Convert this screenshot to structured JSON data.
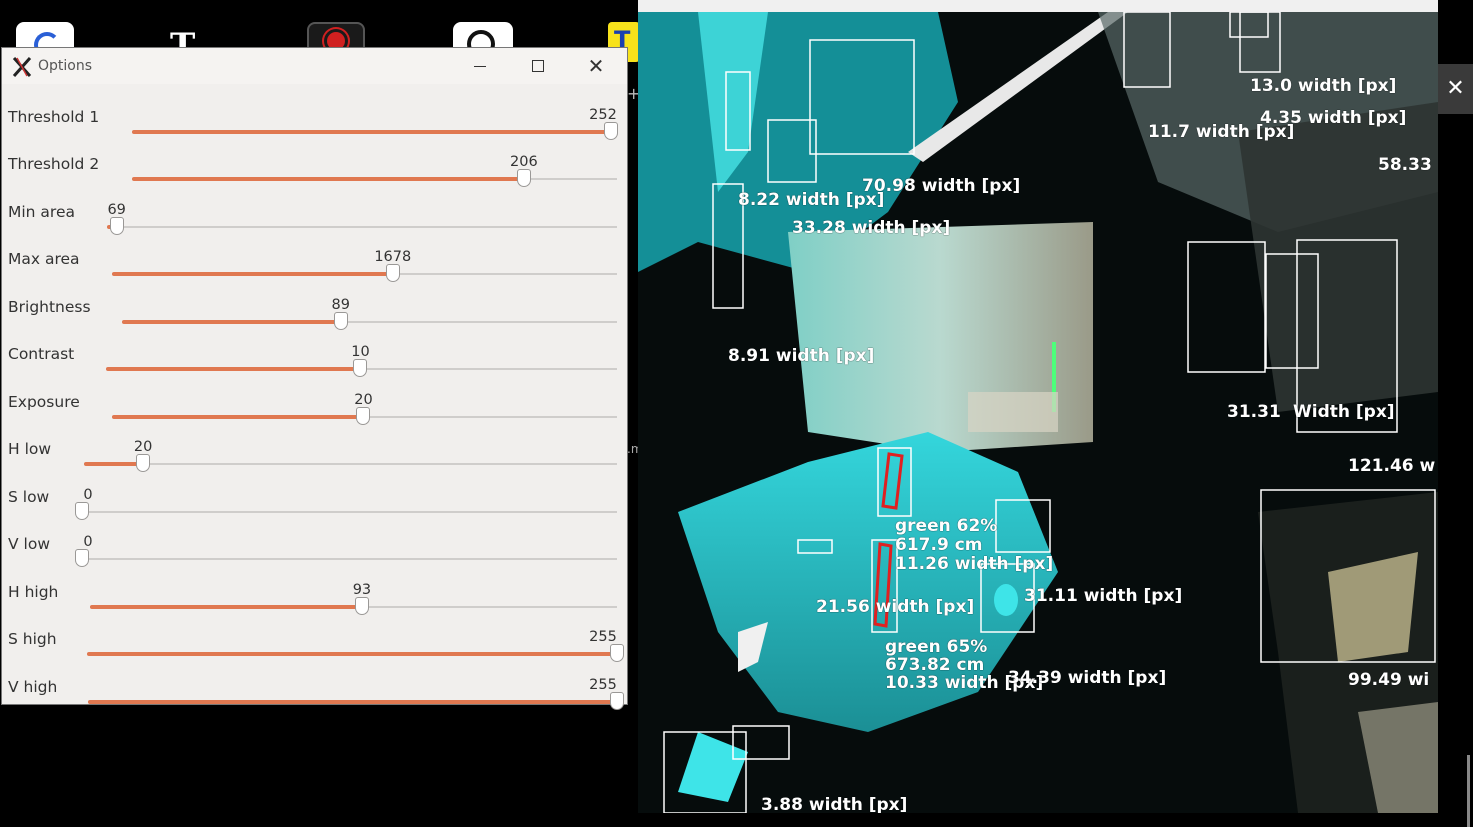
{
  "desktop": {
    "icons": [
      "app-icon-1",
      "text-app-icon",
      "red-dots-app-icon",
      "record-app-icon",
      "yellow-t-app-icon"
    ]
  },
  "options_window": {
    "title": "Options",
    "sliders": [
      {
        "label": "Threshold 1",
        "value": "252",
        "fraction": 0.988
      },
      {
        "label": "Threshold 2",
        "value": "206",
        "fraction": 0.808
      },
      {
        "label": "Min area",
        "value": "69",
        "fraction": 0.019
      },
      {
        "label": "Max area",
        "value": "1678",
        "fraction": 0.556
      },
      {
        "label": "Brightness",
        "value": "89",
        "fraction": 0.442
      },
      {
        "label": "Contrast",
        "value": "10",
        "fraction": 0.498
      },
      {
        "label": "Exposure",
        "value": "20",
        "fraction": 0.498
      },
      {
        "label": "H low",
        "value": "20",
        "fraction": 0.111
      },
      {
        "label": "S low",
        "value": "0",
        "fraction": 0.0
      },
      {
        "label": "V low",
        "value": "0",
        "fraction": 0.0
      },
      {
        "label": "H high",
        "value": "93",
        "fraction": 0.516
      },
      {
        "label": "S high",
        "value": "255",
        "fraction": 1.0
      },
      {
        "label": "V high",
        "value": "255",
        "fraction": 1.0
      }
    ]
  },
  "camera_window": {
    "labels": [
      "13.0 width [px]",
      "4.35 width [px]",
      "11.7 width [px]",
      "58.33",
      "70.98 width [px]",
      "8.22 width [px]",
      "33.28 width [px]",
      "8.91 width [px]",
      "31.31",
      "Width [px]",
      "121.46 w",
      "green 62%",
      "617.9 cm",
      "11.26 width [px]",
      "21.56 width [px]",
      "31.11 width [px]",
      "green 65%",
      "673.82 cm",
      "10.33 width [px]",
      "34.39 width [px]",
      "99.49 wi",
      "3.88 width [px]"
    ]
  },
  "colors": {
    "slider_fill": "#e07850",
    "slider_track": "#cfcdcb",
    "window_bg": "#f1efed",
    "overlay_box": "#ffffff",
    "target_box": "#e02020",
    "scene_cyan": "#2bd3d8"
  }
}
